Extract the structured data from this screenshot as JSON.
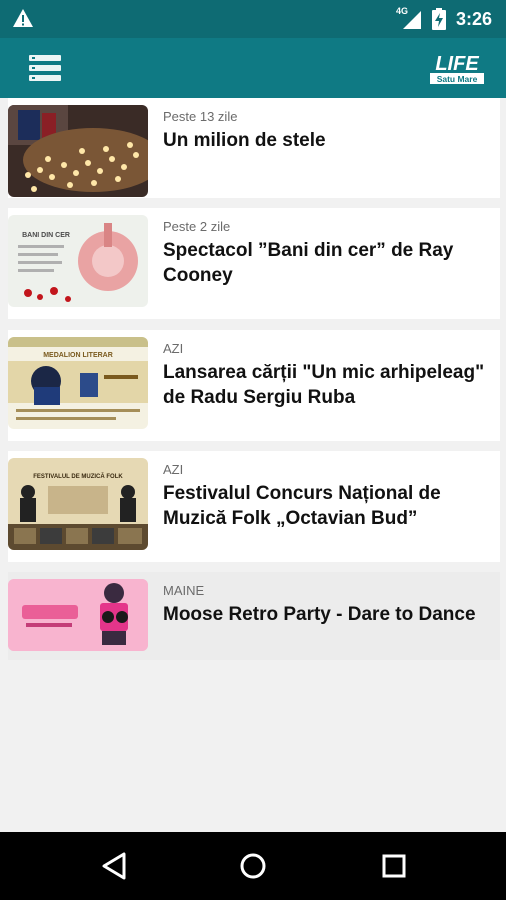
{
  "status": {
    "network": "4G",
    "time": "3:26"
  },
  "app": {
    "logo_main": "LIFE",
    "logo_sub": "Satu Mare"
  },
  "events": [
    {
      "when": "Peste 13 zile",
      "title": "Un milion de stele"
    },
    {
      "when": "Peste 2 zile",
      "title": "Spectacol ”Bani din cer” de Ray Cooney",
      "thumb_text": "BANI DIN CER"
    },
    {
      "when": "AZI",
      "title": "Lansarea cărții \"Un mic arhipeleag\" de Radu Sergiu Ruba",
      "thumb_text": "MEDALION LITERAR"
    },
    {
      "when": "AZI",
      "title": "Festivalul Concurs Național de Muzică Folk „Octavian Bud”",
      "thumb_text": "FESTIVALUL DE MUZICĂ FOLK"
    },
    {
      "when": "MAINE",
      "title": "Moose Retro Party - Dare to Dance"
    }
  ],
  "colors": {
    "statusbar": "#0e6b73",
    "appbar": "#0f7a84"
  }
}
